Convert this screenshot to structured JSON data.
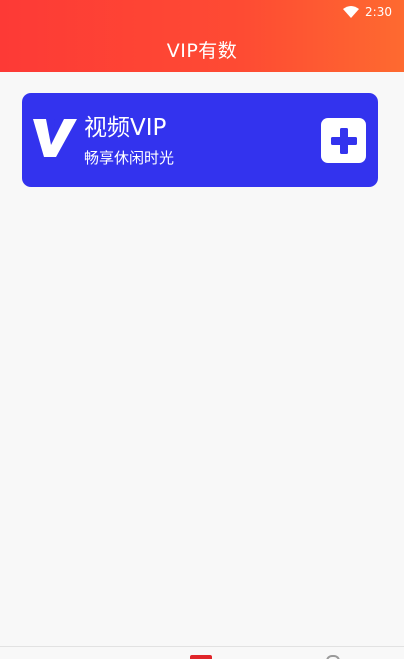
{
  "status_bar": {
    "time": "2:30",
    "wifi_icon": "wifi-icon"
  },
  "header": {
    "title": "VIP有数"
  },
  "vip_card": {
    "logo_icon": "v-logo-icon",
    "title": "视频VIP",
    "subtitle": "畅享休闲时光",
    "action_icon": "plus-icon"
  },
  "bottom_nav": {
    "items": [
      {
        "icon": "home-icon"
      },
      {
        "icon": "profile-icon"
      }
    ]
  },
  "colors": {
    "header_gradient_start": "#fd3a36",
    "header_gradient_end": "#fe6a30",
    "card_background": "#3333ee",
    "page_background": "#f8f8f8",
    "nav_active": "#e0252a"
  }
}
